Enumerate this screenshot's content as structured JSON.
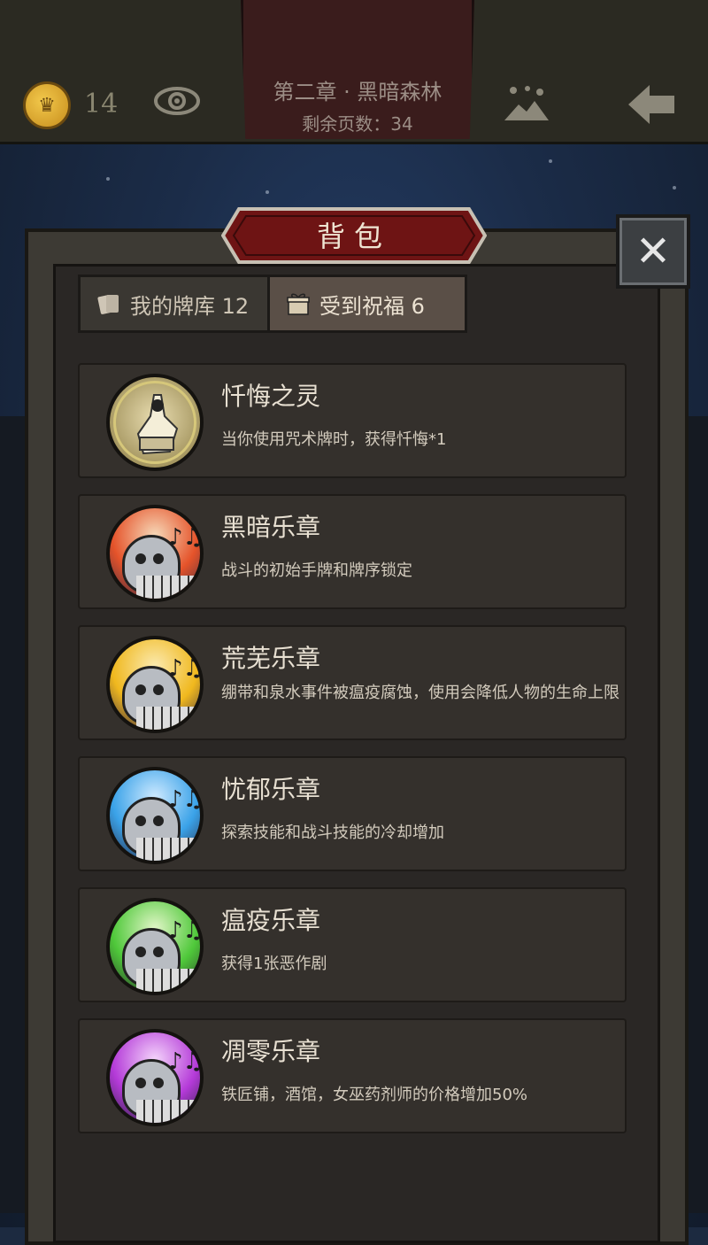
{
  "topbar": {
    "coins": "14",
    "chapter_title": "第二章 · 黑暗森林",
    "pages_left": "剩余页数：34"
  },
  "panel": {
    "title": "背包",
    "close_glyph": "✕"
  },
  "tabs": [
    {
      "label": "我的牌库 12",
      "active": false
    },
    {
      "label": "受到祝福 6",
      "active": true
    }
  ],
  "blessings": [
    {
      "name": "忏悔之灵",
      "desc": "当你使用咒术牌时，获得忏悔*1",
      "flame_color": "#d9c98a"
    },
    {
      "name": "黑暗乐章",
      "desc": "战斗的初始手牌和牌序锁定",
      "flame_color": "#e5532a"
    },
    {
      "name": "荒芜乐章",
      "desc": "绷带和泉水事件被瘟疫腐蚀，使用会降低人物的生命上限",
      "flame_color": "#f0b81e"
    },
    {
      "name": "忧郁乐章",
      "desc": "探索技能和战斗技能的冷却增加",
      "flame_color": "#3aa2e8"
    },
    {
      "name": "瘟疫乐章",
      "desc": "获得1张恶作剧",
      "flame_color": "#4fc83a"
    },
    {
      "name": "凋零乐章",
      "desc": "铁匠铺，酒馆，女巫药剂师的价格增加50%",
      "flame_color": "#b43ad8"
    }
  ]
}
